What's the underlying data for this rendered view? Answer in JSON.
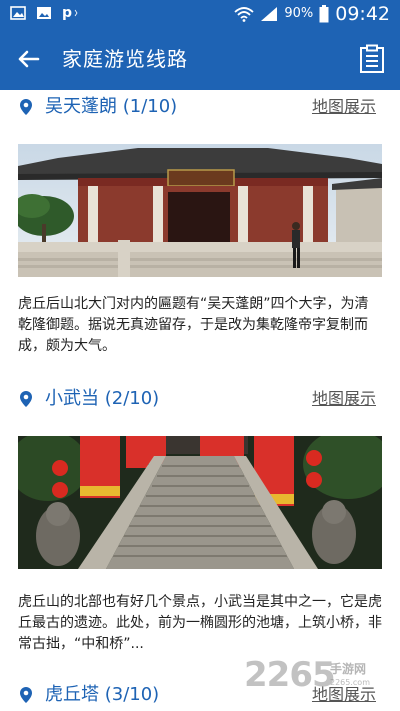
{
  "status_bar": {
    "left_icons": [
      "image-icon",
      "gallery-icon",
      "p-logo-icon"
    ],
    "p_label": "p",
    "battery_percent": "90%",
    "time": "09:42"
  },
  "app_bar": {
    "title": "家庭游览线路",
    "back_icon": "arrow-left-icon",
    "list_icon": "clipboard-list-icon"
  },
  "stops": [
    {
      "name": "吴天蓬朗 (1/10)",
      "map_link": "地图展示",
      "photo": "temple-gate-photo",
      "description": " 虎丘后山北大门对内的匾题有“吴天蓬朗”四个大字，为清乾隆御题。据说无真迹留存，于是改为集乾隆帝字复制而成，颇为大气。"
    },
    {
      "name": "小武当 (2/10)",
      "map_link": "地图展示",
      "photo": "stone-stairway-photo",
      "description": "虎丘山的北部也有好几个景点，小武当是其中之一，它是虎丘最古的遗迹。此处，前为一椭圆形的池塘，上筑小桥，非常古拙，“中和桥”..."
    },
    {
      "name": "虎丘塔 (3/10)",
      "map_link": "地图展示"
    }
  ],
  "watermark": {
    "number": "2265",
    "text": "手游网",
    "url": "2265.com"
  },
  "colors": {
    "primary": "#1e63b4",
    "link": "#555555",
    "text": "#222222"
  }
}
